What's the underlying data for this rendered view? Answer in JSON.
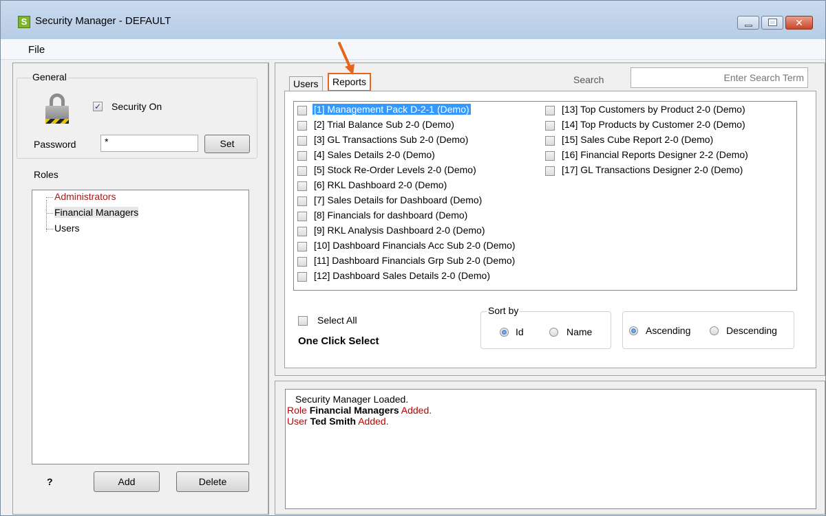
{
  "window": {
    "title": "Security Manager - DEFAULT",
    "app_icon_letter": "S",
    "close_glyph": "✕"
  },
  "menu": {
    "file": "File"
  },
  "general": {
    "label": "General",
    "security_on_label": "Security On",
    "security_on_checked": true,
    "password_label": "Password",
    "password_value": "*",
    "set_button": "Set"
  },
  "roles": {
    "label": "Roles",
    "items": [
      "Administrators",
      "Financial Managers",
      "Users"
    ],
    "help": "?",
    "add_button": "Add",
    "delete_button": "Delete"
  },
  "tabs": [
    {
      "label": "Users"
    },
    {
      "label": "Reports"
    }
  ],
  "search": {
    "label": "Search",
    "placeholder": "Enter Search Term"
  },
  "reports": {
    "column1": [
      "[1] Management Pack D-2-1 (Demo)",
      "[2] Trial Balance Sub 2-0 (Demo)",
      "[3] GL Transactions Sub 2-0 (Demo)",
      "[4] Sales Details 2-0 (Demo)",
      "[5] Stock Re-Order Levels 2-0 (Demo)",
      "[6] RKL Dashboard 2-0 (Demo)",
      "[7] Sales Details for Dashboard (Demo)",
      "[8] Financials for dashboard (Demo)",
      "[9] RKL Analysis Dashboard 2-0 (Demo)",
      "[10] Dashboard Financials Acc Sub 2-0 (Demo)",
      "[11] Dashboard Financials Grp Sub 2-0 (Demo)",
      "[12] Dashboard Sales Details 2-0 (Demo)"
    ],
    "column2": [
      "[13] Top Customers by Product 2-0 (Demo)",
      "[14] Top Products by Customer 2-0 (Demo)",
      "[15] Sales Cube Report 2-0 (Demo)",
      "[16] Financial Reports Designer 2-2 (Demo)",
      "[17] GL Transactions Designer 2-0 (Demo)"
    ]
  },
  "select_all": "Select All",
  "one_click_select": "One Click Select",
  "sort": {
    "label": "Sort by",
    "id": "Id",
    "name": "Name",
    "ascending": "Ascending",
    "descending": "Descending"
  },
  "log": {
    "line1": "Security Manager Loaded.",
    "line2_prefix": "Role ",
    "line2_bold": "Financial Managers",
    "line2_suffix": " Added.",
    "line3_prefix": "User ",
    "line3_bold": "Ted Smith",
    "line3_suffix": " Added."
  },
  "colors": {
    "accent_highlight": "#e8641c",
    "selection": "#3399ff",
    "role_admin": "#a01c1c"
  }
}
